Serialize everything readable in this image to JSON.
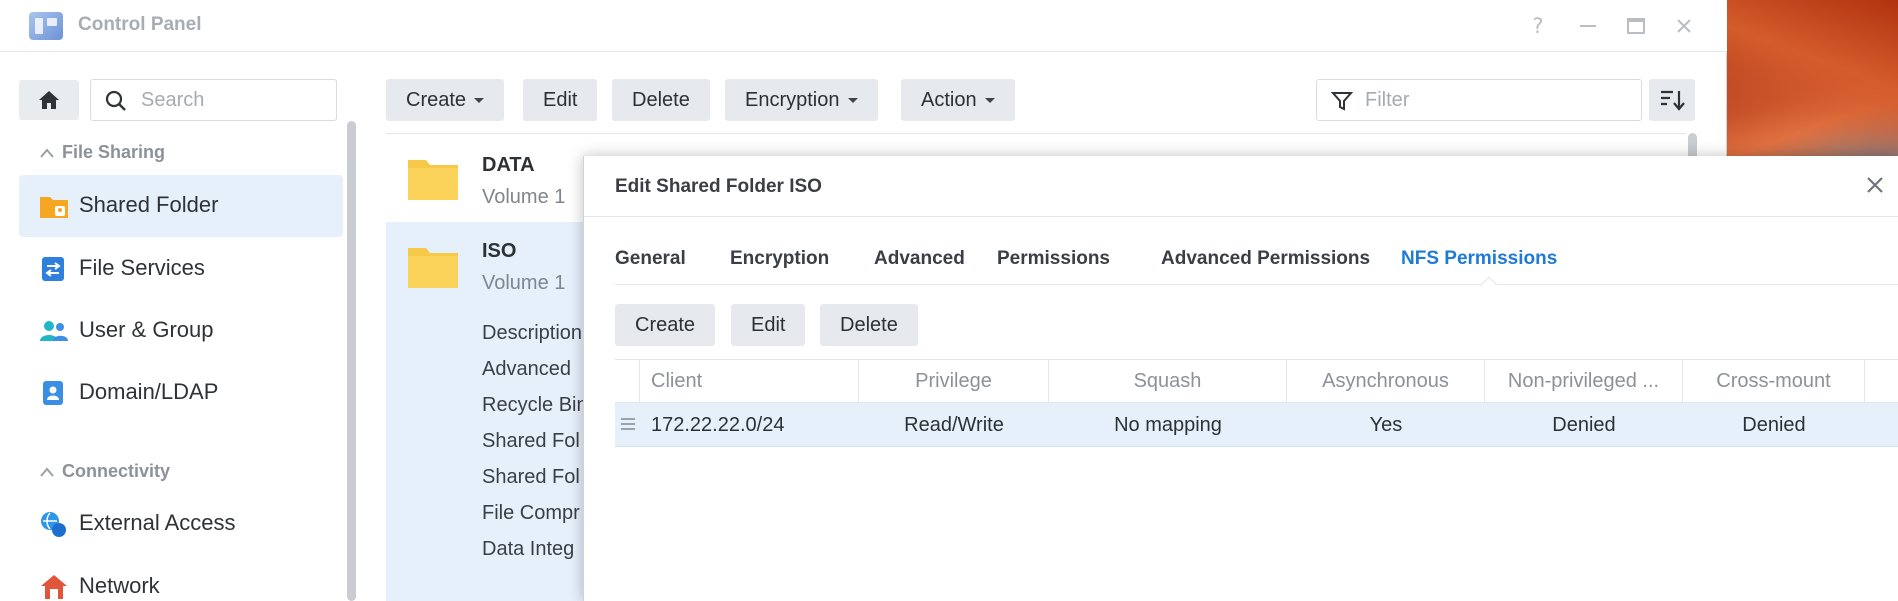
{
  "window": {
    "title": "Control Panel",
    "controls": {
      "help": "?",
      "minimize": "—",
      "maximize": "□",
      "close": "✕"
    }
  },
  "sidebar": {
    "search_placeholder": "Search",
    "sections": [
      {
        "title": "File Sharing",
        "chevron": "^"
      },
      {
        "title": "Connectivity",
        "chevron": "^"
      }
    ],
    "items": [
      {
        "label": "Shared Folder",
        "icon": "shared-folder-icon",
        "color": "#f5a623",
        "active": true
      },
      {
        "label": "File Services",
        "icon": "file-services-icon",
        "color": "#2f7fdc",
        "active": false
      },
      {
        "label": "User & Group",
        "icon": "user-group-icon",
        "color": "#1fb7c8",
        "active": false
      },
      {
        "label": "Domain/LDAP",
        "icon": "domain-ldap-icon",
        "color": "#3b8ee6",
        "active": false
      },
      {
        "label": "External Access",
        "icon": "external-access-icon",
        "color": "#2f95e6",
        "active": false
      },
      {
        "label": "Network",
        "icon": "network-icon",
        "color": "#e0553b",
        "active": false
      }
    ]
  },
  "toolbar": {
    "create": "Create",
    "edit": "Edit",
    "delete": "Delete",
    "encryption": "Encryption",
    "action": "Action",
    "filter_placeholder": "Filter"
  },
  "folders": [
    {
      "name": "DATA",
      "volume": "Volume 1",
      "selected": false
    },
    {
      "name": "ISO",
      "volume": "Volume 1",
      "selected": true,
      "details": [
        "Description",
        "Advanced",
        "Recycle Bin",
        "Shared Fol",
        "Shared Fol",
        "File Compr",
        "Data Integ"
      ]
    }
  ],
  "dialog": {
    "title": "Edit Shared Folder ISO",
    "close": "×",
    "tabs": [
      "General",
      "Encryption",
      "Advanced",
      "Permissions",
      "Advanced Permissions",
      "NFS Permissions"
    ],
    "active_tab": "NFS Permissions",
    "buttons": {
      "create": "Create",
      "edit": "Edit",
      "delete": "Delete"
    },
    "columns": [
      "Client",
      "Privilege",
      "Squash",
      "Asynchronous",
      "Non-privileged ...",
      "Cross-mount"
    ],
    "rows": [
      {
        "client": "172.22.22.0/24",
        "privilege": "Read/Write",
        "squash": "No mapping",
        "asynchronous": "Yes",
        "non_privileged": "Denied",
        "cross_mount": "Denied"
      }
    ]
  },
  "colors": {
    "accent": "#1f7ad6",
    "selection": "#e6f0fb",
    "button": "#e6e9ed",
    "folder": "#f7c948"
  }
}
